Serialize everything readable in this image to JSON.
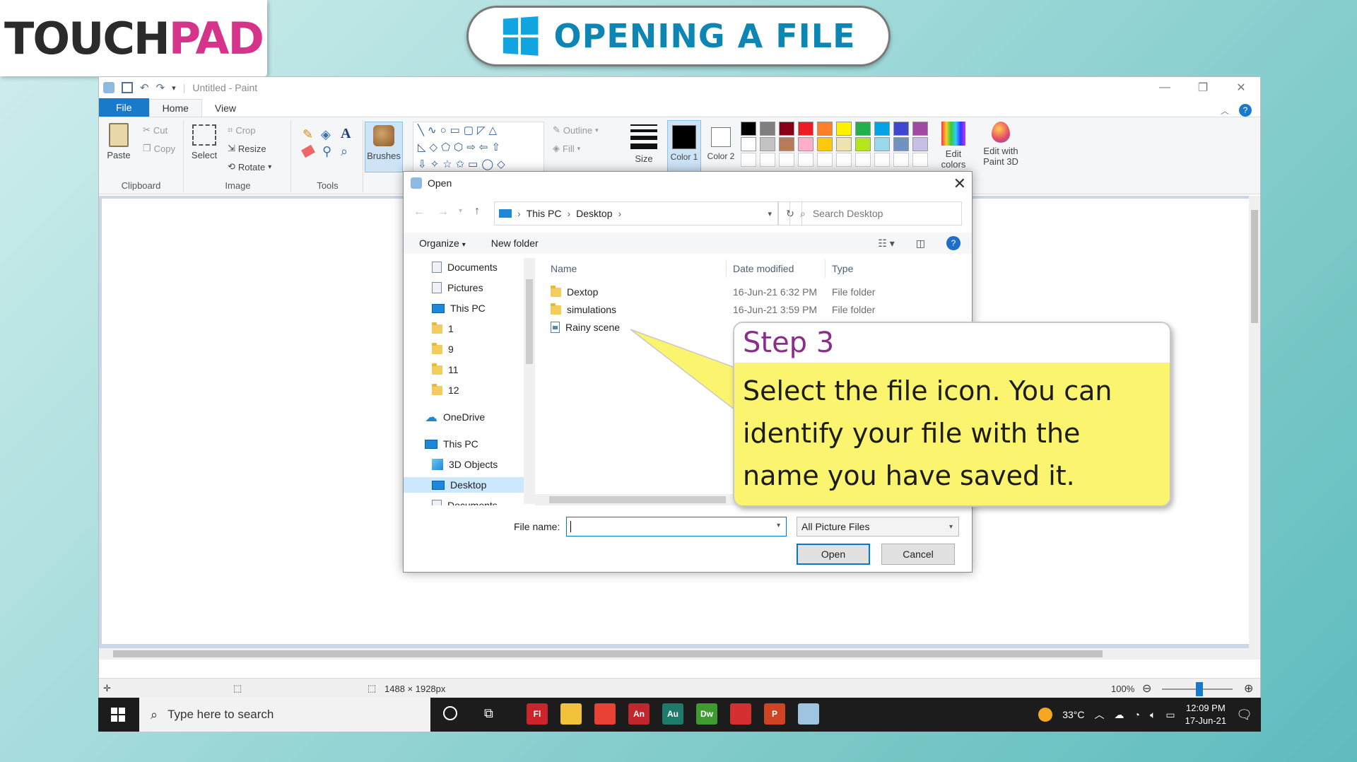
{
  "logo": {
    "part_a": "TOUCH",
    "part_b": "PAD",
    "brand_pink": "#d6338a"
  },
  "title": {
    "text": "OPENING A FILE",
    "icon": "windows-logo-icon",
    "color": "#0d86b3"
  },
  "paint": {
    "window_title": "Untitled - Paint",
    "tabs": [
      "File",
      "Home",
      "View"
    ],
    "ribbon": {
      "clipboard": {
        "paste": "Paste",
        "cut": "Cut",
        "copy": "Copy",
        "label": "Clipboard"
      },
      "image": {
        "select": "Select",
        "crop": "Crop",
        "resize": "Resize",
        "rotate": "Rotate",
        "label": "Image"
      },
      "tools": {
        "label": "Tools"
      },
      "brushes": "Brushes",
      "outline": "Outline",
      "fill": "Fill",
      "size": "Size",
      "color1": "Color 1",
      "color2": "Color 2",
      "edit_colors": "Edit colors",
      "edit_3d": "Edit with Paint 3D",
      "palette": [
        "#000000",
        "#7f7f7f",
        "#880015",
        "#ed1c24",
        "#ff7f27",
        "#fff200",
        "#22b14c",
        "#00a2e8",
        "#3f48cc",
        "#a349a4",
        "#ffffff",
        "#c3c3c3",
        "#b97a57",
        "#ffaec9",
        "#ffc90e",
        "#efe4b0",
        "#b5e61d",
        "#99d9ea",
        "#7092be",
        "#c8bfe7"
      ]
    },
    "status": {
      "dimensions": "1488 × 1928px",
      "zoom": "100%"
    }
  },
  "dialog": {
    "title": "Open",
    "breadcrumb": [
      "This PC",
      "Desktop"
    ],
    "search_placeholder": "Search Desktop",
    "organize": "Organize",
    "new_folder": "New folder",
    "nav": [
      {
        "label": "Documents",
        "icon": "documents-icon",
        "pinned": true
      },
      {
        "label": "Pictures",
        "icon": "pictures-icon",
        "pinned": true
      },
      {
        "label": "This PC",
        "icon": "computer-icon",
        "pinned": true
      },
      {
        "label": "1",
        "icon": "folder-icon"
      },
      {
        "label": "9",
        "icon": "folder-icon"
      },
      {
        "label": "11",
        "icon": "folder-icon"
      },
      {
        "label": "12",
        "icon": "folder-icon"
      },
      {
        "label": "OneDrive",
        "icon": "cloud-icon"
      },
      {
        "label": "This PC",
        "icon": "computer-icon"
      },
      {
        "label": "3D Objects",
        "icon": "cube-icon"
      },
      {
        "label": "Desktop",
        "icon": "desktop-icon",
        "selected": true
      },
      {
        "label": "Documents",
        "icon": "documents-icon"
      }
    ],
    "columns": {
      "name": "Name",
      "date": "Date modified",
      "type": "Type"
    },
    "files": [
      {
        "name": "Dextop",
        "date": "16-Jun-21 6:32 PM",
        "type": "File folder",
        "icon": "folder-icon"
      },
      {
        "name": "simulations",
        "date": "16-Jun-21 3:59 PM",
        "type": "File folder",
        "icon": "folder-icon"
      },
      {
        "name": "Rainy scene",
        "date": "",
        "type": "",
        "icon": "picture-file-icon"
      }
    ],
    "file_name_label": "File name:",
    "file_name_value": "",
    "filter": "All Picture Files",
    "open": "Open",
    "cancel": "Cancel"
  },
  "callout": {
    "heading": "Step 3",
    "body": "Select the file icon. You can identify your file with the name you have saved it."
  },
  "taskbar": {
    "search_placeholder": "Type here to search",
    "weather": "33°C",
    "time": "12:09 PM",
    "date": "17-Jun-21",
    "apps": [
      {
        "label": "Fl",
        "color": "#c9252b",
        "name": "flash-icon"
      },
      {
        "label": "",
        "color": "#f2c23c",
        "name": "file-explorer-icon"
      },
      {
        "label": "",
        "color": "#e94235",
        "name": "chrome-icon"
      },
      {
        "label": "An",
        "color": "#c0262c",
        "name": "animate-icon"
      },
      {
        "label": "Au",
        "color": "#1e7a69",
        "name": "audition-icon"
      },
      {
        "label": "Dw",
        "color": "#3f9b2f",
        "name": "dreamweaver-icon"
      },
      {
        "label": "",
        "color": "#d32f2f",
        "name": "acrobat-icon"
      },
      {
        "label": "P",
        "color": "#d04423",
        "name": "powerpoint-icon"
      },
      {
        "label": "",
        "color": "#9ec4e0",
        "name": "paint-icon"
      }
    ]
  }
}
